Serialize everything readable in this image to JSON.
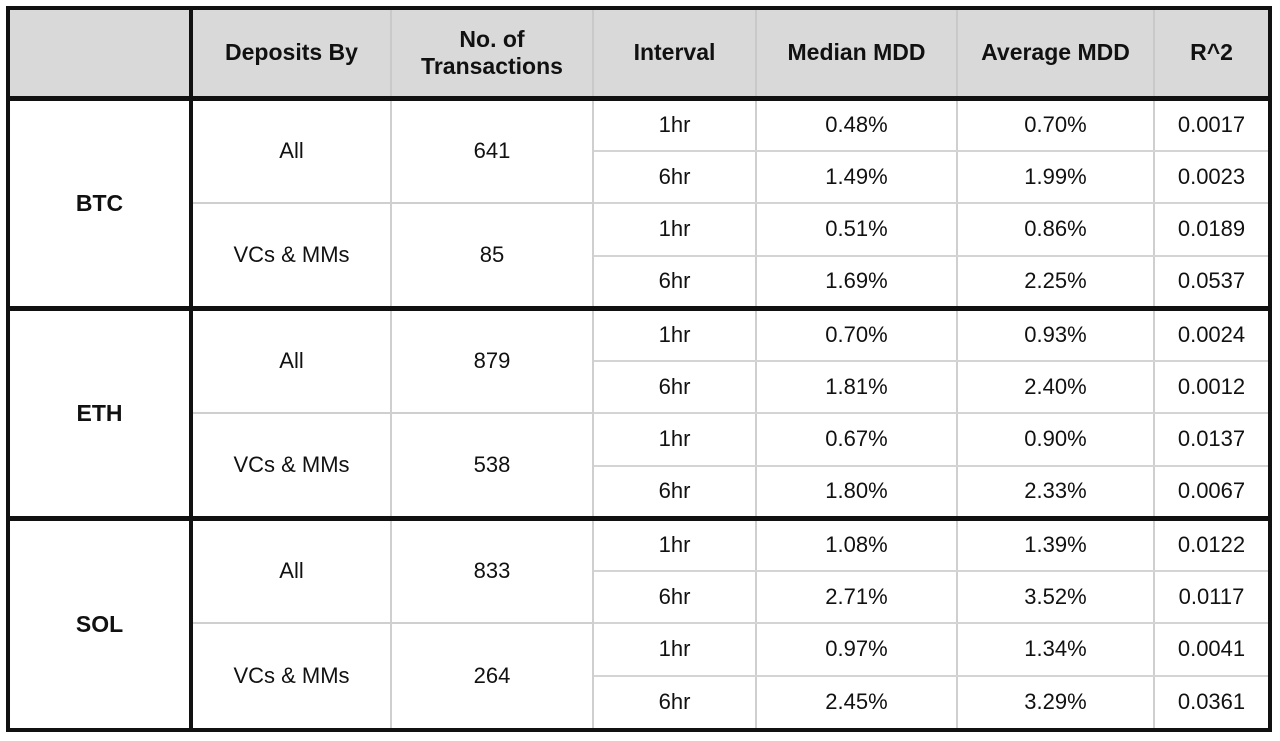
{
  "table": {
    "columns": [
      {
        "key": "asset",
        "label": ""
      },
      {
        "key": "deposits",
        "label": "Deposits By"
      },
      {
        "key": "tx",
        "label": "No. of\nTransactions"
      },
      {
        "key": "interval",
        "label": "Interval"
      },
      {
        "key": "median",
        "label": "Median MDD"
      },
      {
        "key": "average",
        "label": "Average MDD"
      },
      {
        "key": "r2",
        "label": "R^2"
      }
    ],
    "header": {
      "corner": "",
      "deposits_by": "Deposits By",
      "no_of_transactions_line1": "No. of",
      "no_of_transactions_line2": "Transactions",
      "interval": "Interval",
      "median_mdd": "Median MDD",
      "average_mdd": "Average MDD",
      "r2": "R^2"
    },
    "colors": {
      "header_background": "#d9d9d9",
      "text": "#111111",
      "thick_border": "#111111",
      "thin_border": "#cfcfcf",
      "cell_background": "#ffffff"
    },
    "groups": [
      {
        "asset": "BTC",
        "blocks": [
          {
            "deposits_by": "All",
            "transactions": "641",
            "rows": [
              {
                "interval": "1hr",
                "median_mdd": "0.48%",
                "average_mdd": "0.70%",
                "r2": "0.0017"
              },
              {
                "interval": "6hr",
                "median_mdd": "1.49%",
                "average_mdd": "1.99%",
                "r2": "0.0023"
              }
            ]
          },
          {
            "deposits_by": "VCs & MMs",
            "transactions": "85",
            "rows": [
              {
                "interval": "1hr",
                "median_mdd": "0.51%",
                "average_mdd": "0.86%",
                "r2": "0.0189"
              },
              {
                "interval": "6hr",
                "median_mdd": "1.69%",
                "average_mdd": "2.25%",
                "r2": "0.0537"
              }
            ]
          }
        ]
      },
      {
        "asset": "ETH",
        "blocks": [
          {
            "deposits_by": "All",
            "transactions": "879",
            "rows": [
              {
                "interval": "1hr",
                "median_mdd": "0.70%",
                "average_mdd": "0.93%",
                "r2": "0.0024"
              },
              {
                "interval": "6hr",
                "median_mdd": "1.81%",
                "average_mdd": "2.40%",
                "r2": "0.0012"
              }
            ]
          },
          {
            "deposits_by": "VCs & MMs",
            "transactions": "538",
            "rows": [
              {
                "interval": "1hr",
                "median_mdd": "0.67%",
                "average_mdd": "0.90%",
                "r2": "0.0137"
              },
              {
                "interval": "6hr",
                "median_mdd": "1.80%",
                "average_mdd": "2.33%",
                "r2": "0.0067"
              }
            ]
          }
        ]
      },
      {
        "asset": "SOL",
        "blocks": [
          {
            "deposits_by": "All",
            "transactions": "833",
            "rows": [
              {
                "interval": "1hr",
                "median_mdd": "1.08%",
                "average_mdd": "1.39%",
                "r2": "0.0122"
              },
              {
                "interval": "6hr",
                "median_mdd": "2.71%",
                "average_mdd": "3.52%",
                "r2": "0.0117"
              }
            ]
          },
          {
            "deposits_by": "VCs & MMs",
            "transactions": "264",
            "rows": [
              {
                "interval": "1hr",
                "median_mdd": "0.97%",
                "average_mdd": "1.34%",
                "r2": "0.0041"
              },
              {
                "interval": "6hr",
                "median_mdd": "2.45%",
                "average_mdd": "3.29%",
                "r2": "0.0361"
              }
            ]
          }
        ]
      }
    ]
  },
  "chart_data": {
    "type": "table",
    "title": "",
    "columns": [
      "Asset",
      "Deposits By",
      "No. of Transactions",
      "Interval",
      "Median MDD",
      "Average MDD",
      "R^2"
    ],
    "rows": [
      [
        "BTC",
        "All",
        641,
        "1hr",
        0.48,
        0.7,
        0.0017
      ],
      [
        "BTC",
        "All",
        641,
        "6hr",
        1.49,
        1.99,
        0.0023
      ],
      [
        "BTC",
        "VCs & MMs",
        85,
        "1hr",
        0.51,
        0.86,
        0.0189
      ],
      [
        "BTC",
        "VCs & MMs",
        85,
        "6hr",
        1.69,
        2.25,
        0.0537
      ],
      [
        "ETH",
        "All",
        879,
        "1hr",
        0.7,
        0.93,
        0.0024
      ],
      [
        "ETH",
        "All",
        879,
        "6hr",
        1.81,
        2.4,
        0.0012
      ],
      [
        "ETH",
        "VCs & MMs",
        538,
        "1hr",
        0.67,
        0.9,
        0.0137
      ],
      [
        "ETH",
        "VCs & MMs",
        538,
        "6hr",
        1.8,
        2.33,
        0.0067
      ],
      [
        "SOL",
        "All",
        833,
        "1hr",
        1.08,
        1.39,
        0.0122
      ],
      [
        "SOL",
        "All",
        833,
        "6hr",
        2.71,
        3.52,
        0.0117
      ],
      [
        "SOL",
        "VCs & MMs",
        264,
        "1hr",
        0.97,
        1.34,
        0.0041
      ],
      [
        "SOL",
        "VCs & MMs",
        264,
        "6hr",
        2.45,
        3.29,
        0.0361
      ]
    ],
    "units": {
      "Median MDD": "%",
      "Average MDD": "%"
    }
  }
}
